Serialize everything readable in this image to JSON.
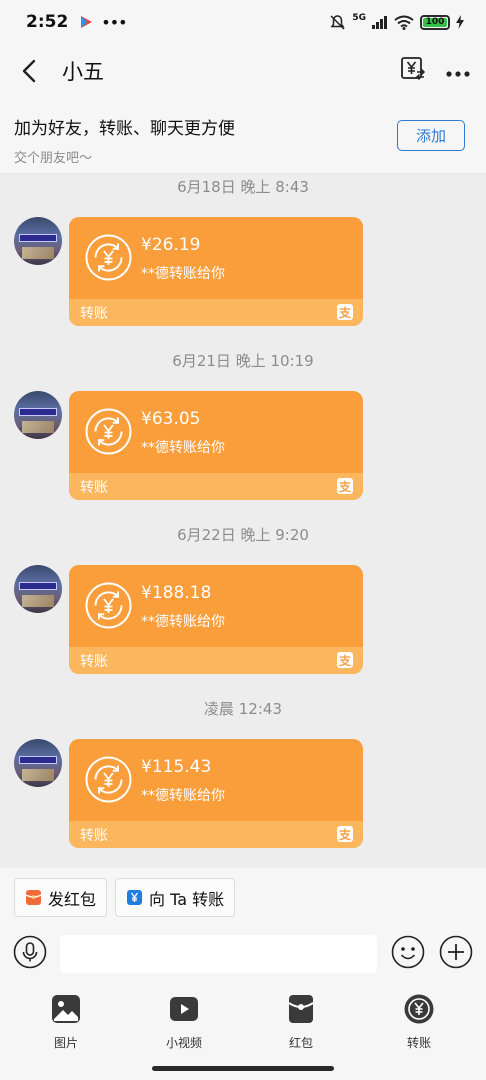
{
  "status_bar": {
    "time": "2:52",
    "network": "5G",
    "battery": "100",
    "battery_level": 1.0
  },
  "nav": {
    "title": "小五",
    "back_icon": "chevron-left-icon",
    "transfer_icon": "yuan-transfer-icon",
    "more_icon": "more-dots-icon"
  },
  "banner": {
    "title": "加为好友，转账、聊天更方便",
    "subtitle": "交个朋友吧～",
    "add_label": "添加"
  },
  "messages": [
    {
      "time": "6月18日 晚上 8:43",
      "amount": "¥26.19",
      "desc": "**德转账给你",
      "label": "转账"
    },
    {
      "time": "6月21日 晚上 10:19",
      "amount": "¥63.05",
      "desc": "**德转账给你",
      "label": "转账"
    },
    {
      "time": "6月22日 晚上 9:20",
      "amount": "¥188.18",
      "desc": "**德转账给你",
      "label": "转账"
    },
    {
      "time": "凌晨 12:43",
      "amount": "¥115.43",
      "desc": "**德转账给你",
      "label": "转账"
    }
  ],
  "card_logo_text": "支",
  "quick_actions": {
    "red_packet": "发红包",
    "transfer": "向 Ta 转账"
  },
  "input": {
    "placeholder": ""
  },
  "toolbar": {
    "image": "图片",
    "video": "小视频",
    "red_packet": "红包",
    "transfer": "转账"
  },
  "colors": {
    "card": "#fa9d3b",
    "card_footer": "#fbb65e",
    "accent_blue": "#2d7bd2",
    "background": "#ededed"
  }
}
